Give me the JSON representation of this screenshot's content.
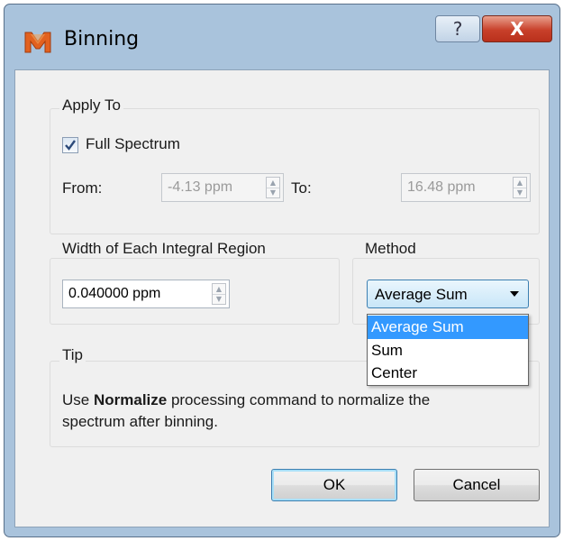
{
  "window": {
    "title": "Binning",
    "help_label": "?",
    "close_label": "X",
    "app_icon": "m-logo-icon"
  },
  "apply_to": {
    "heading": "Apply To",
    "full_spectrum_label": "Full Spectrum",
    "full_spectrum_checked": true,
    "from_label": "From:",
    "from_value": "-4.13 ppm",
    "to_label": "To:",
    "to_value": "16.48 ppm"
  },
  "width": {
    "heading": "Width of Each Integral Region",
    "value": "0.040000 ppm"
  },
  "method": {
    "heading": "Method",
    "selected": "Average Sum",
    "options": [
      "Average Sum",
      "Sum",
      "Center"
    ]
  },
  "tip": {
    "heading": "Tip",
    "line1_prefix": "Use ",
    "line1_bold": "Normalize",
    "line1_suffix": " processing command to normalize the",
    "line2": "spectrum after binning."
  },
  "buttons": {
    "ok": "OK",
    "cancel": "Cancel"
  },
  "colors": {
    "accent": "#3399ff",
    "titlebar": "#a9c3dc",
    "close": "#c8402a"
  }
}
